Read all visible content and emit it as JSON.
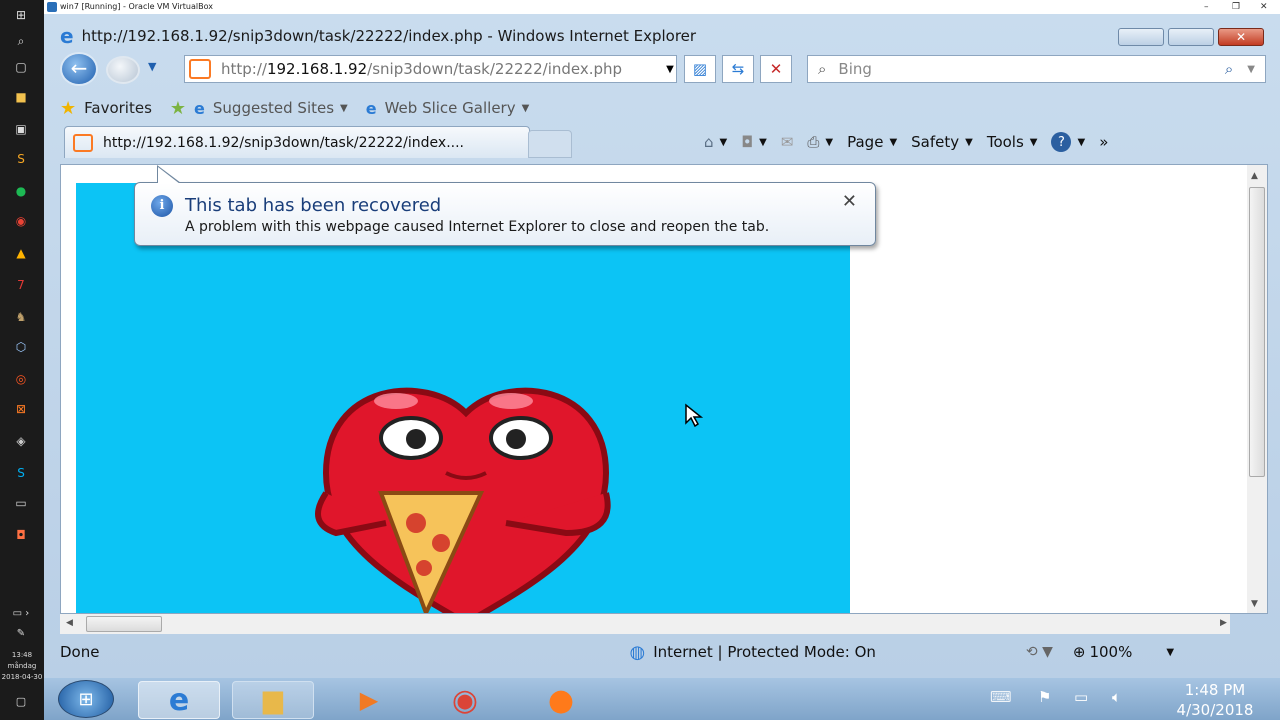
{
  "vm_title": "win7 [Running] - Oracle VM VirtualBox",
  "host_clock": {
    "time": "13:48",
    "day": "måndag",
    "date": "2018-04-30"
  },
  "window": {
    "title": "http://192.168.1.92/snip3down/task/22222/index.php - Windows Internet Explorer"
  },
  "address": {
    "scheme": "http://",
    "host": "192.168.1.92",
    "path": "/snip3down/task/22222/index.php"
  },
  "search": {
    "placeholder": "Bing"
  },
  "favorites_bar": {
    "favorites": "Favorites",
    "suggested": "Suggested Sites",
    "slice": "Web Slice Gallery"
  },
  "tab": {
    "title": "http://192.168.1.92/snip3down/task/22222/index...."
  },
  "command_bar": {
    "page": "Page",
    "safety": "Safety",
    "tools": "Tools"
  },
  "notification": {
    "title": "This tab has been recovered",
    "message": "A problem with this webpage caused Internet Explorer to close and reopen the tab."
  },
  "status": {
    "left": "Done",
    "zone": "Internet | Protected Mode: On",
    "zoom": "100%"
  },
  "taskbar_clock": {
    "time": "1:48 PM",
    "date": "4/30/2018"
  },
  "colors": {
    "page_background": "#0cc4f5",
    "heart": "#e0162b",
    "xampp_orange": "#fb7a24"
  }
}
